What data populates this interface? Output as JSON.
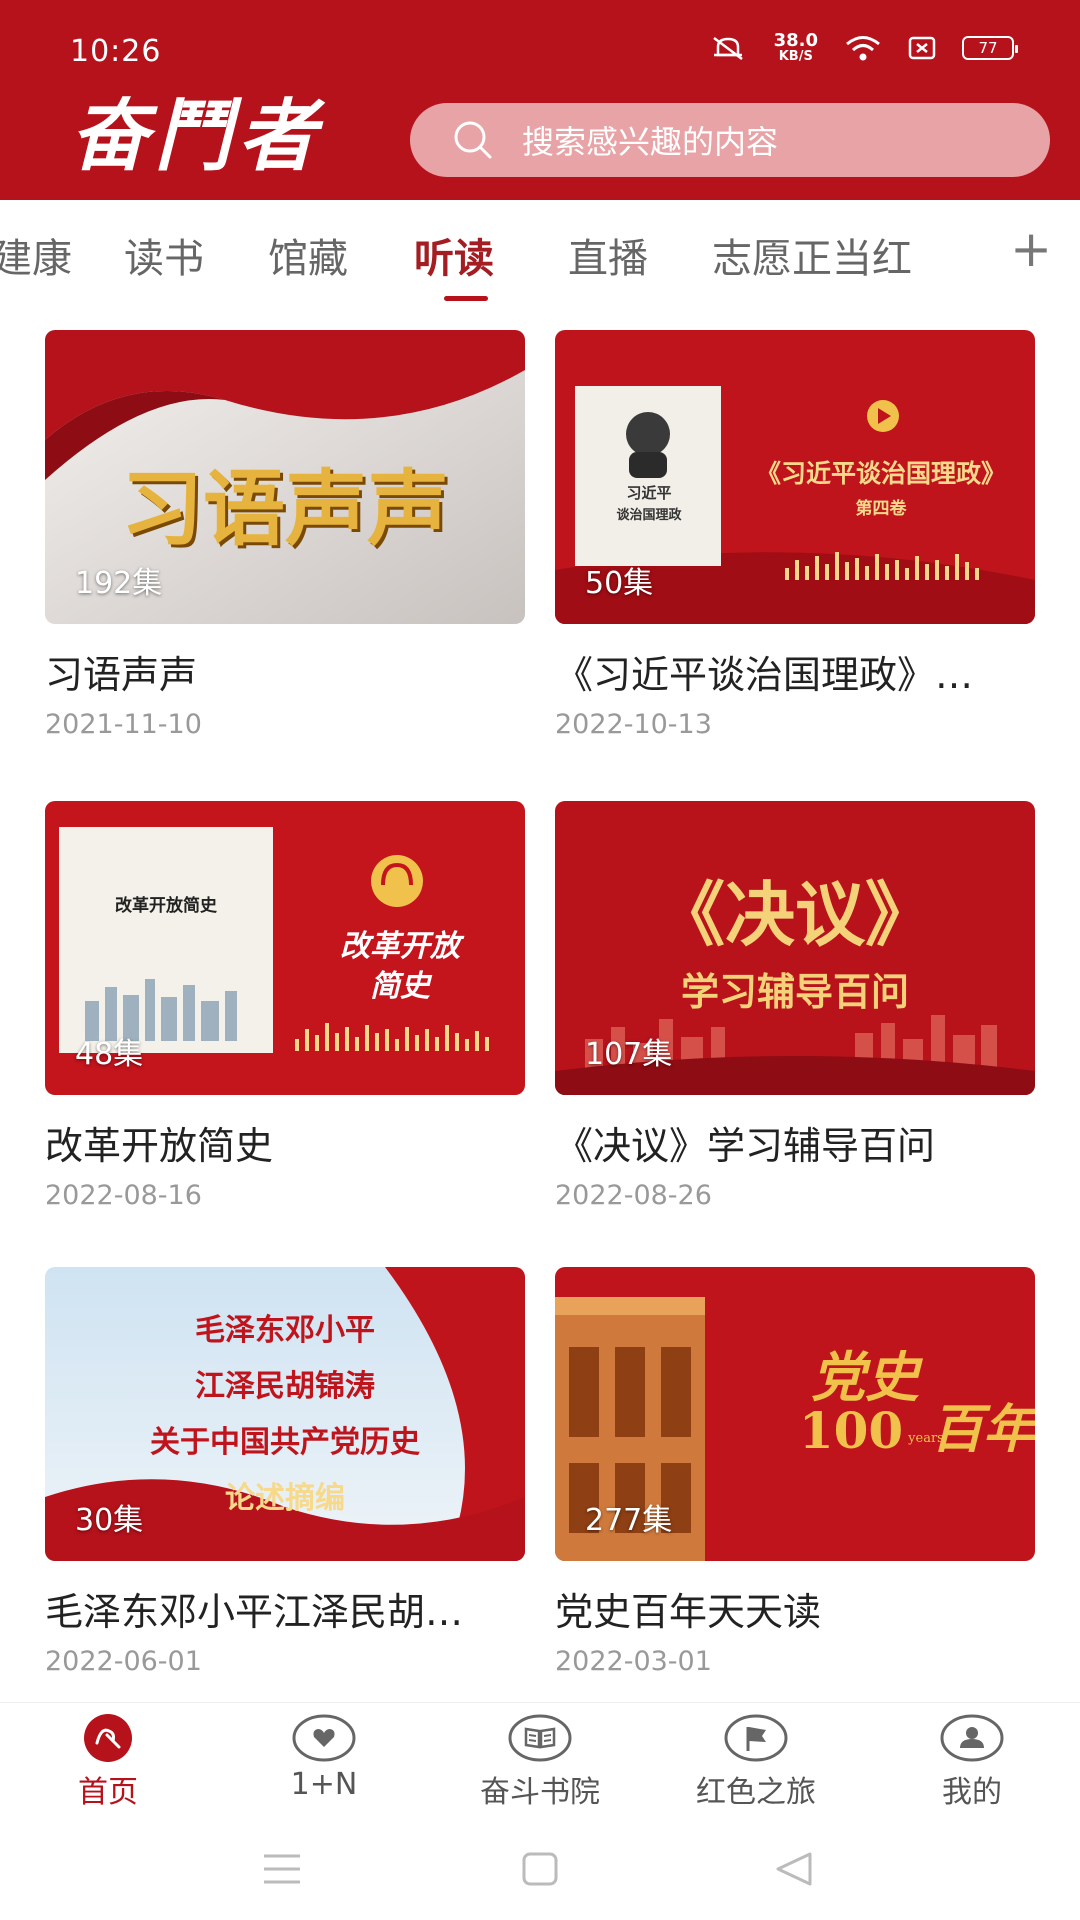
{
  "status": {
    "time": "10:26",
    "speed_value": "38.0",
    "speed_unit": "KB/S",
    "battery": "77"
  },
  "header": {
    "logo": "奋鬥者",
    "search_placeholder": "搜索感兴趣的内容"
  },
  "tabs": [
    {
      "label": "建康"
    },
    {
      "label": "读书"
    },
    {
      "label": "馆藏"
    },
    {
      "label": "听读",
      "active": true
    },
    {
      "label": "直播"
    },
    {
      "label": "志愿正当红"
    }
  ],
  "cards": [
    {
      "title": "习语声声",
      "date": "2021-11-10",
      "count": "192集",
      "cover_text": "习语声声"
    },
    {
      "title": "《习近平谈治国理政》…",
      "date": "2022-10-13",
      "count": "50集",
      "cover_text": "《习近平谈治国理政》",
      "cover_sub": "第四卷",
      "book_line1": "习近平",
      "book_line2": "谈治国理政"
    },
    {
      "title": "改革开放简史",
      "date": "2022-08-16",
      "count": "48集",
      "cover_text": "改革开放",
      "cover_text2": "简史",
      "book_title": "改革开放简史"
    },
    {
      "title": "《决议》学习辅导百问",
      "date": "2022-08-26",
      "count": "107集",
      "cover_text": "《决议》",
      "cover_sub": "学习辅导百问"
    },
    {
      "title": "毛泽东邓小平江泽民胡…",
      "date": "2022-06-01",
      "count": "30集",
      "cover_lines": [
        "毛泽东邓小平",
        "江泽民胡锦涛",
        "关于中国共产党历史",
        "论述摘编"
      ]
    },
    {
      "title": "党史百年天天读",
      "date": "2022-03-01",
      "count": "277集",
      "cover_text": "党史",
      "cover_num": "100",
      "cover_text2": "百年",
      "cover_small": "years"
    }
  ],
  "bottom_nav": [
    {
      "label": "首页",
      "icon": "home-logo-icon",
      "active": true
    },
    {
      "label": "1+N",
      "icon": "heart-icon"
    },
    {
      "label": "奋斗书院",
      "icon": "book-icon"
    },
    {
      "label": "红色之旅",
      "icon": "flag-icon"
    },
    {
      "label": "我的",
      "icon": "user-icon"
    }
  ],
  "colors": {
    "brand_red": "#b5121b",
    "active_tab": "#a31d22"
  }
}
